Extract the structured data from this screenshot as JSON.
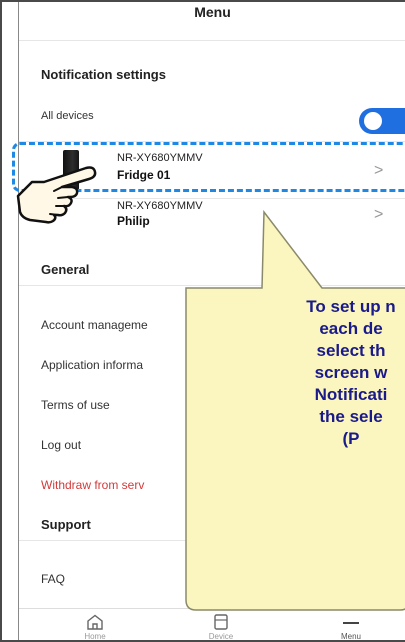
{
  "header": {
    "title": "Menu"
  },
  "notification": {
    "section_title": "Notification settings",
    "all_devices_label": "All devices",
    "all_devices_enabled": true,
    "devices": [
      {
        "model": "NR-XY680YMMV",
        "name": "Fridge 01"
      },
      {
        "model": "NR-XY680YMMV",
        "name": "Philip"
      }
    ]
  },
  "general": {
    "section_title": "General",
    "items": [
      "Account manageme",
      "Application informa",
      "Terms of use",
      "Log out",
      "Withdraw from serv"
    ]
  },
  "support": {
    "section_title": "Support",
    "items": [
      "FAQ"
    ]
  },
  "bottom_nav": [
    {
      "label": "Home",
      "icon": "home-icon"
    },
    {
      "label": "Device",
      "icon": "device-icon"
    },
    {
      "label": "Menu",
      "icon": "menu-icon",
      "active": true
    }
  ],
  "callout": {
    "lines": [
      "To set up n",
      "each de",
      "select th",
      "screen w",
      "Notificati",
      "the sele",
      "(P"
    ]
  },
  "colors": {
    "accent": "#1f6fe0",
    "dashed_highlight": "#1e88e5",
    "withdraw_text": "#d23a3a",
    "callout_fill": "#fbf6bf",
    "callout_text": "#1a1a8a"
  }
}
